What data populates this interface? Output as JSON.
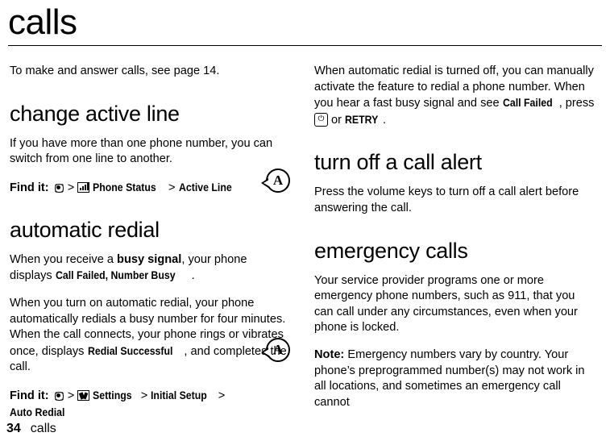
{
  "page": {
    "title": "calls",
    "footer": {
      "page_number": "34",
      "chapter": "calls"
    }
  },
  "left_column": {
    "intro": "To make and answer calls, see page 14.",
    "sections": [
      {
        "heading": "change active line",
        "body": "If you have more than one phone number, you can switch from one line to another.",
        "find_it": {
          "label": "Find it:",
          "steps": [
            "Phone Status",
            "Active Line"
          ],
          "icons": [
            "menu-key-icon",
            "phone-status-icon"
          ],
          "separator": ">"
        }
      },
      {
        "heading": "automatic redial",
        "paragraphs": [
          {
            "pre": "When you receive a ",
            "bold": "busy signal",
            "mid": ", your phone displays ",
            "value": "Call Failed, Number Busy",
            "post": "."
          },
          {
            "pre": "When you turn on automatic redial, your phone automatically redials a busy number for four minutes. When the call connects, your phone rings or vibrates once, displays ",
            "value": "Redial Successful",
            "post": ", and completes the call."
          }
        ],
        "find_it": {
          "label": "Find it:",
          "steps": [
            "Settings",
            "Initial Setup",
            "Auto Redial"
          ],
          "icons": [
            "menu-key-icon",
            "settings-tools-icon"
          ],
          "separator": ">"
        }
      }
    ],
    "note_icon": {
      "letter": "A",
      "name": "note-marker-icon"
    }
  },
  "right_column": {
    "paragraphs": [
      {
        "pre": "When automatic redial is turned off, you can manually activate the feature to redial a phone number. When you hear a fast busy signal and see ",
        "value": "Call Failed",
        "mid": ", press ",
        "key": "power-key-icon",
        "post_pre": " or ",
        "value2": "RETRY",
        "post": "."
      }
    ],
    "sections": [
      {
        "heading": "turn off a call alert",
        "body": "Press the volume keys to turn off a call alert before answering the call."
      },
      {
        "heading": "emergency calls",
        "body": "Your service provider programs one or more emergency phone numbers, such as 911, that you can call under any circumstances, even when your phone is locked.",
        "note": {
          "label": "Note:",
          "text": " Emergency numbers vary by country. Your phone’s preprogrammed number(s) may not work in all locations, and sometimes an emergency call cannot"
        }
      }
    ],
    "note_icon": {
      "letter": "A",
      "name": "note-marker-icon"
    }
  }
}
